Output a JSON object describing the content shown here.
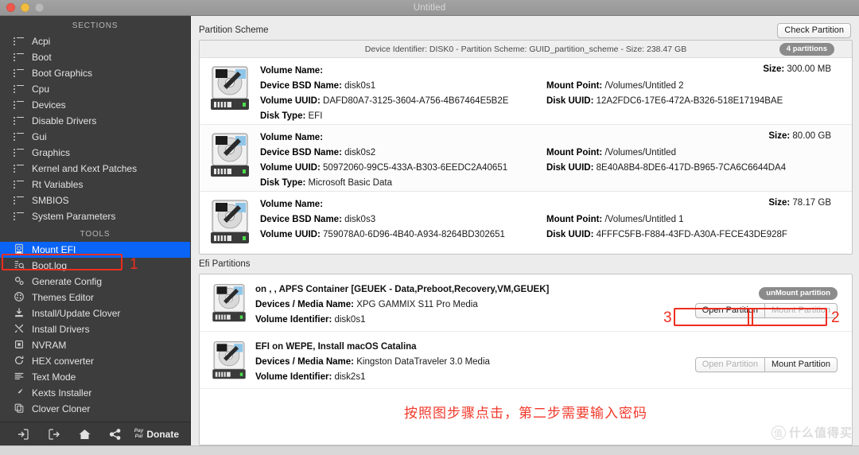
{
  "window": {
    "title": "Untitled",
    "traffic_lights": [
      "close-red",
      "minimize-yellow",
      "zoom-disabled"
    ]
  },
  "sidebar": {
    "sections_header": "SECTIONS",
    "tools_header": "TOOLS",
    "sections": [
      {
        "label": "Acpi",
        "icon": "list-icon"
      },
      {
        "label": "Boot",
        "icon": "list-icon"
      },
      {
        "label": "Boot Graphics",
        "icon": "list-icon"
      },
      {
        "label": "Cpu",
        "icon": "list-icon"
      },
      {
        "label": "Devices",
        "icon": "list-icon"
      },
      {
        "label": "Disable Drivers",
        "icon": "list-icon"
      },
      {
        "label": "Gui",
        "icon": "list-icon"
      },
      {
        "label": "Graphics",
        "icon": "list-icon"
      },
      {
        "label": "Kernel and Kext Patches",
        "icon": "list-icon"
      },
      {
        "label": "Rt Variables",
        "icon": "list-icon"
      },
      {
        "label": "SMBIOS",
        "icon": "list-icon"
      },
      {
        "label": "System Parameters",
        "icon": "list-icon"
      }
    ],
    "tools": [
      {
        "label": "Mount EFI",
        "icon": "disk-mount-icon",
        "selected": true
      },
      {
        "label": "Boot.log",
        "icon": "log-search-icon",
        "selected": false
      },
      {
        "label": "Generate Config",
        "icon": "gears-icon",
        "selected": false
      },
      {
        "label": "Themes Editor",
        "icon": "palette-icon",
        "selected": false
      },
      {
        "label": "Install/Update Clover",
        "icon": "download-icon",
        "selected": false
      },
      {
        "label": "Install Drivers",
        "icon": "tools-icon",
        "selected": false
      },
      {
        "label": "NVRAM",
        "icon": "chip-icon",
        "selected": false
      },
      {
        "label": "HEX converter",
        "icon": "refresh-icon",
        "selected": false
      },
      {
        "label": "Text Mode",
        "icon": "text-lines-icon",
        "selected": false
      },
      {
        "label": "Kexts Installer",
        "icon": "plug-icon",
        "selected": false
      },
      {
        "label": "Clover Cloner",
        "icon": "copy-icon",
        "selected": false
      }
    ],
    "bottom_bar": {
      "icons": [
        "import-icon",
        "export-icon",
        "home-icon",
        "share-icon"
      ],
      "paypal_line1": "Pay",
      "paypal_line2": "Pal",
      "donate_label": "Donate"
    }
  },
  "main": {
    "partition_scheme": {
      "section_title": "Partition Scheme",
      "check_button": "Check Partition",
      "device_summary": "Device Identifier: DISK0 - Partition Scheme: GUID_partition_scheme - Size: 238.47 GB",
      "partitions_badge": "4 partitions",
      "labels": {
        "volume_name": "Volume Name:",
        "device_bsd": "Device BSD Name:",
        "volume_uuid": "Volume UUID:",
        "disk_type": "Disk Type:",
        "mount_point": "Mount Point:",
        "disk_uuid": "Disk UUID:",
        "size": "Size:"
      },
      "rows": [
        {
          "volume_name": "",
          "device_bsd": "disk0s1",
          "volume_uuid": "DAFD80A7-3125-3604-A756-4B67464E5B2E",
          "disk_type": "EFI",
          "mount_point": "/Volumes/Untitled 2",
          "disk_uuid": "12A2FDC6-17E6-472A-B326-518E17194BAE",
          "size": "300.00 MB"
        },
        {
          "volume_name": "",
          "device_bsd": "disk0s2",
          "volume_uuid": "50972060-99C5-433A-B303-6EEDC2A40651",
          "disk_type": "Microsoft Basic Data",
          "mount_point": "/Volumes/Untitled",
          "disk_uuid": "8E40A8B4-8DE6-417D-B965-7CA6C6644DA4",
          "size": "80.00 GB"
        },
        {
          "volume_name": "",
          "device_bsd": "disk0s3",
          "volume_uuid": "759078A0-6D96-4B40-A934-8264BD302651",
          "disk_type": "",
          "mount_point": "/Volumes/Untitled 1",
          "disk_uuid": "4FFFC5FB-F884-43FD-A30A-FECE43DE928F",
          "size": "78.17 GB"
        }
      ]
    },
    "efi_partitions": {
      "section_title": "Efi Partitions",
      "labels": {
        "devices_media": "Devices / Media Name:",
        "volume_identifier": "Volume Identifier:"
      },
      "rows": [
        {
          "title": "on , , APFS Container [GEUEK - Data,Preboot,Recovery,VM,GEUEK]",
          "devices_media": "XPG GAMMIX S11 Pro Media",
          "volume_identifier": "disk0s1",
          "status_pill": "unMount partition",
          "open_button": "Open Partition",
          "open_disabled": false,
          "mount_button": "Mount Partition",
          "mount_disabled": true
        },
        {
          "title": "EFI on WEPE, Install macOS Catalina",
          "devices_media": "Kingston DataTraveler 3.0 Media",
          "volume_identifier": "disk2s1",
          "status_pill": "",
          "open_button": "Open Partition",
          "open_disabled": true,
          "mount_button": "Mount Partition",
          "mount_disabled": false
        }
      ],
      "note": "按照图步骤点击，第二步需要输入密码"
    }
  },
  "annotations": {
    "step1": "1",
    "step2": "2",
    "step3": "3",
    "color": "#ee2d20"
  },
  "watermark": {
    "mark": "值",
    "text": "什么值得买"
  }
}
